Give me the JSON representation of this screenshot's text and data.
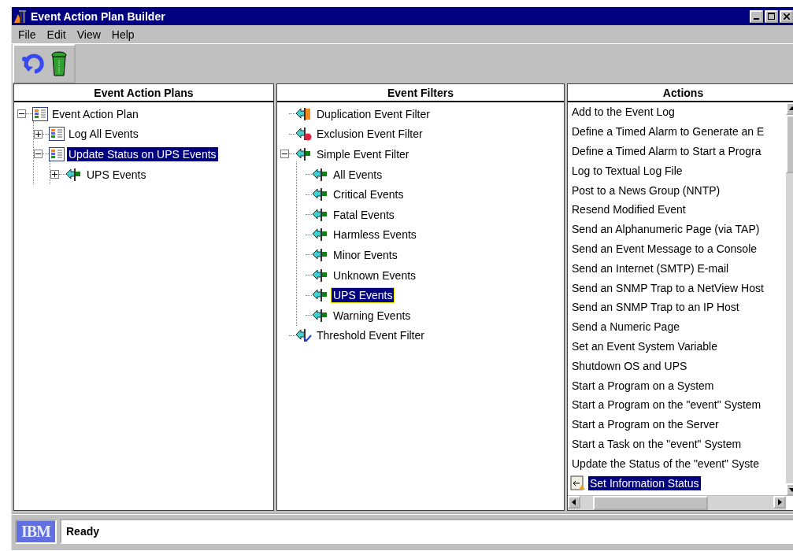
{
  "window": {
    "title": "Event Action Plan Builder"
  },
  "menu": [
    "File",
    "Edit",
    "View",
    "Help"
  ],
  "plans": {
    "header": "Event Action Plans",
    "items": [
      {
        "label": "Event Action Plan",
        "kind": "plan",
        "expanded": true,
        "selected": false,
        "children": [
          {
            "label": "Log All Events",
            "kind": "plan",
            "expanded": false,
            "selected": false
          },
          {
            "label": "Update Status on UPS Events",
            "kind": "plan",
            "expanded": true,
            "selected": true,
            "children": [
              {
                "label": "UPS Events",
                "kind": "filter",
                "expanded": false,
                "selected": false
              }
            ]
          }
        ]
      }
    ]
  },
  "filters": {
    "header": "Event Filters",
    "items": [
      {
        "label": "Duplication Event Filter",
        "kind": "duplication",
        "selected": false
      },
      {
        "label": "Exclusion Event Filter",
        "kind": "exclusion",
        "selected": false
      },
      {
        "label": "Simple Event Filter",
        "kind": "filter",
        "expanded": true,
        "selected": false,
        "children": [
          {
            "label": "All Events",
            "kind": "filter",
            "selected": false
          },
          {
            "label": "Critical Events",
            "kind": "filter",
            "selected": false
          },
          {
            "label": "Fatal Events",
            "kind": "filter",
            "selected": false
          },
          {
            "label": "Harmless Events",
            "kind": "filter",
            "selected": false
          },
          {
            "label": "Minor Events",
            "kind": "filter",
            "selected": false
          },
          {
            "label": "Unknown Events",
            "kind": "filter",
            "selected": false
          },
          {
            "label": "UPS Events",
            "kind": "filter",
            "selected": true
          },
          {
            "label": "Warning Events",
            "kind": "filter",
            "selected": false
          }
        ]
      },
      {
        "label": "Threshold Event Filter",
        "kind": "threshold",
        "selected": false
      }
    ]
  },
  "actions": {
    "header": "Actions",
    "items": [
      {
        "label": "Add to the Event Log",
        "kind": "plain",
        "selected": false
      },
      {
        "label": "Define a Timed Alarm to Generate an E",
        "kind": "plain",
        "selected": false
      },
      {
        "label": "Define a Timed Alarm to Start a Progra",
        "kind": "plain",
        "selected": false
      },
      {
        "label": "Log to Textual Log File",
        "kind": "plain",
        "selected": false
      },
      {
        "label": "Post to a News Group (NNTP)",
        "kind": "plain",
        "selected": false
      },
      {
        "label": "Resend Modified Event",
        "kind": "plain",
        "selected": false
      },
      {
        "label": "Send an Alphanumeric Page (via TAP)",
        "kind": "plain",
        "selected": false
      },
      {
        "label": "Send an Event Message to a Console",
        "kind": "plain",
        "selected": false
      },
      {
        "label": "Send an Internet (SMTP) E-mail",
        "kind": "plain",
        "selected": false
      },
      {
        "label": "Send an SNMP Trap to a NetView Host",
        "kind": "plain",
        "selected": false
      },
      {
        "label": "Send an SNMP Trap to an IP Host",
        "kind": "plain",
        "selected": false
      },
      {
        "label": "Send a Numeric Page",
        "kind": "plain",
        "selected": false
      },
      {
        "label": "Set an Event System Variable",
        "kind": "plain",
        "selected": false
      },
      {
        "label": "Shutdown OS and UPS",
        "kind": "plain",
        "selected": false
      },
      {
        "label": "Start a Program on a System",
        "kind": "plain",
        "selected": false
      },
      {
        "label": "Start a Program on the \"event\" System",
        "kind": "plain",
        "selected": false
      },
      {
        "label": "Start a Program on the Server",
        "kind": "plain",
        "selected": false
      },
      {
        "label": "Start a Task on the \"event\" System",
        "kind": "plain",
        "selected": false
      },
      {
        "label": "Update the Status of the \"event\" Syste",
        "kind": "plain",
        "selected": false
      },
      {
        "label": "Set Information Status",
        "kind": "configured",
        "selected": true
      }
    ]
  },
  "status_bar": {
    "logo": "IBM",
    "message": "Ready"
  }
}
